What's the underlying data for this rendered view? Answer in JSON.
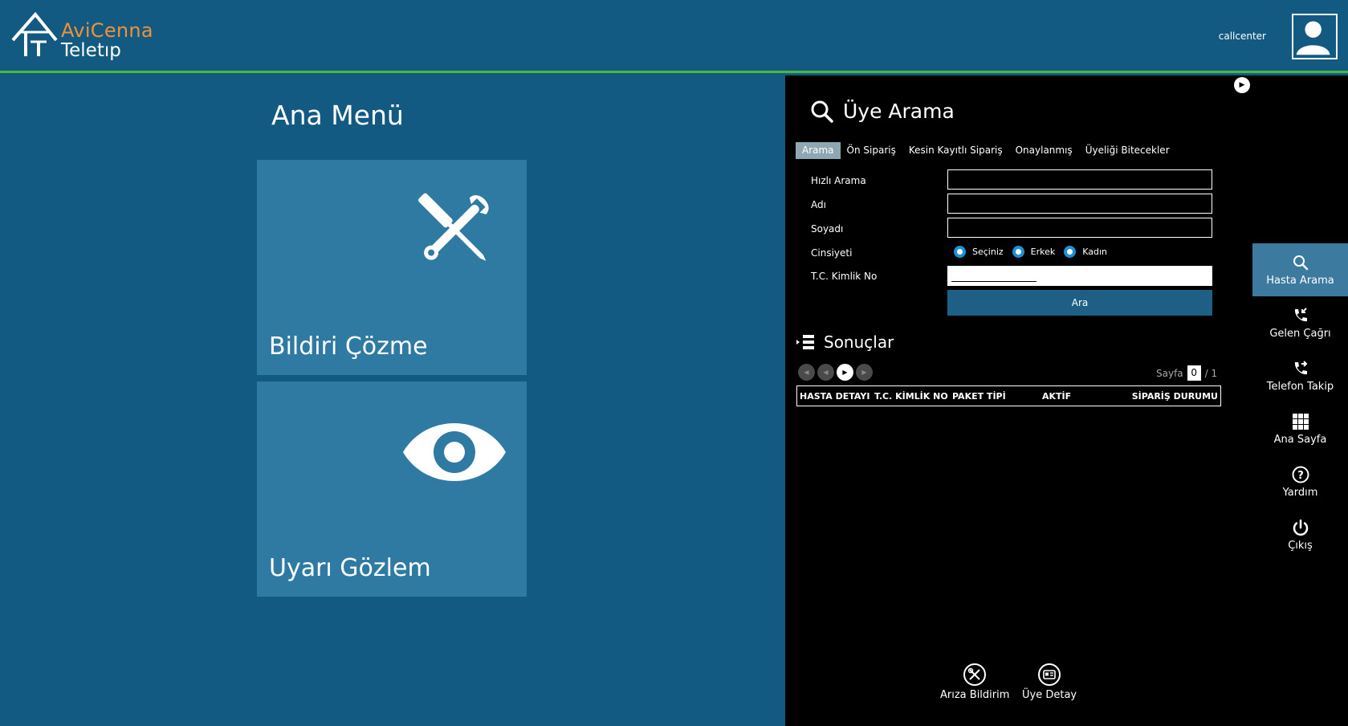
{
  "header": {
    "logo_line1": "AviCenna",
    "logo_line2": "Teletıp",
    "username": "callcenter"
  },
  "main_menu": {
    "title": "Ana Menü",
    "tiles": [
      {
        "label": "Bildiri Çözme",
        "icon": "tools-icon"
      },
      {
        "label": "Uyarı Gözlem",
        "icon": "eye-icon"
      }
    ]
  },
  "search_panel": {
    "title": "Üye Arama",
    "tabs": [
      "Arama",
      "Ön Sipariş",
      "Kesin Kayıtlı Sipariş",
      "Onaylanmış",
      "Üyeliği Bitecekler"
    ],
    "active_tab": "Arama",
    "fields": {
      "quick_search_label": "Hızlı Arama",
      "name_label": "Adı",
      "surname_label": "Soyadı",
      "gender_label": "Cinsiyeti",
      "tc_label": "T.C. Kimlik No"
    },
    "gender_options": [
      "Seçiniz",
      "Erkek",
      "Kadın"
    ],
    "search_button": "Ara",
    "results_title": "Sonuçlar",
    "page_label": "Sayfa",
    "page_current": "0",
    "page_total": "/ 1",
    "columns": [
      "HASTA DETAYI",
      "T.C. KİMLİK NO",
      "PAKET TİPİ",
      "AKTİF",
      "SİPARİŞ DURUMU"
    ]
  },
  "side_nav": [
    {
      "label": "Hasta Arama",
      "icon": "search-icon"
    },
    {
      "label": "Gelen Çağrı",
      "icon": "phone-incoming-icon"
    },
    {
      "label": "Telefon Takip",
      "icon": "phone-track-icon"
    },
    {
      "label": "Ana Sayfa",
      "icon": "grid-icon"
    },
    {
      "label": "Yardım",
      "icon": "help-icon"
    },
    {
      "label": "Çıkış",
      "icon": "power-icon"
    }
  ],
  "bottom_actions": [
    {
      "label": "Arıza Bildirim",
      "icon": "tools-circle-icon"
    },
    {
      "label": "Üye Detay",
      "icon": "id-card-icon"
    }
  ],
  "colors": {
    "background": "#135a82",
    "tile": "#2f7aa3",
    "accent_line": "#4ab83a",
    "logo_orange": "#f0913a",
    "panel": "#000000",
    "active_nav": "#3d7aa0"
  }
}
